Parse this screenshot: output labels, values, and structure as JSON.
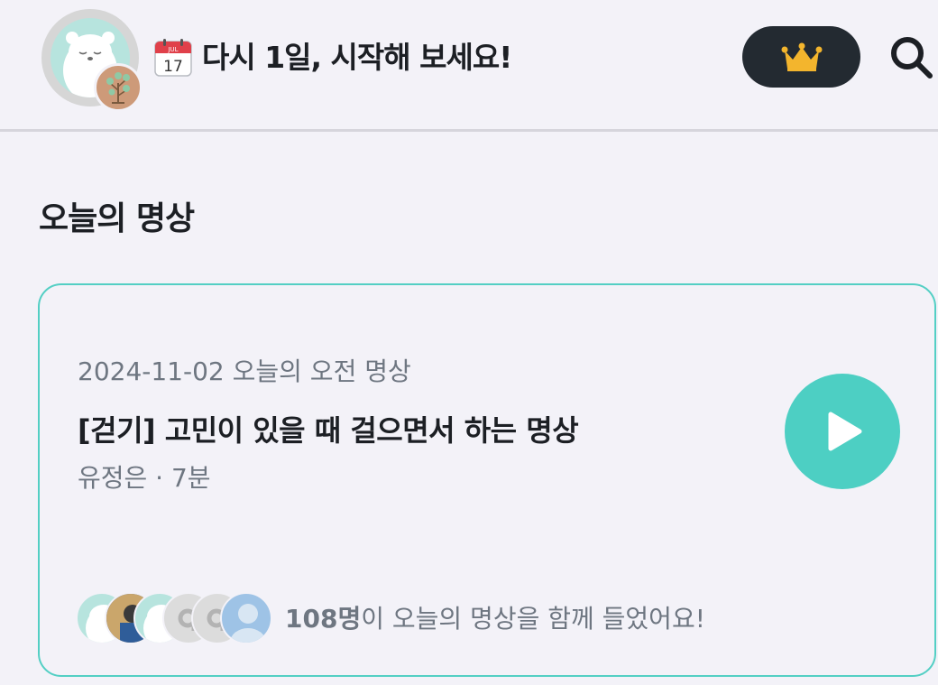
{
  "header": {
    "avatar_icon": "bear-avatar-icon",
    "badge_icon": "tree-badge-icon",
    "calendar_icon": "calendar-icon",
    "calendar_month": "JUL",
    "calendar_day": "17",
    "streak_text": "다시 1일, 시작해 보세요!",
    "premium_icon": "crown-icon",
    "search_icon": "search-icon"
  },
  "section": {
    "title": "오늘의 명상"
  },
  "card": {
    "subtitle": "2024-11-02 오늘의 오전 명상",
    "title": "[걷기] 고민이 있을 때 걸으면서 하는 명상",
    "meta": "유정은 · 7분",
    "play_icon": "play-icon",
    "listener_count": "108명",
    "listener_text": "이 오늘의 명상을 함께 들었어요!"
  },
  "colors": {
    "background": "#f3f2f8",
    "accent": "#4dcfc3",
    "premium_bg": "#232a31",
    "crown": "#f3b52d"
  }
}
